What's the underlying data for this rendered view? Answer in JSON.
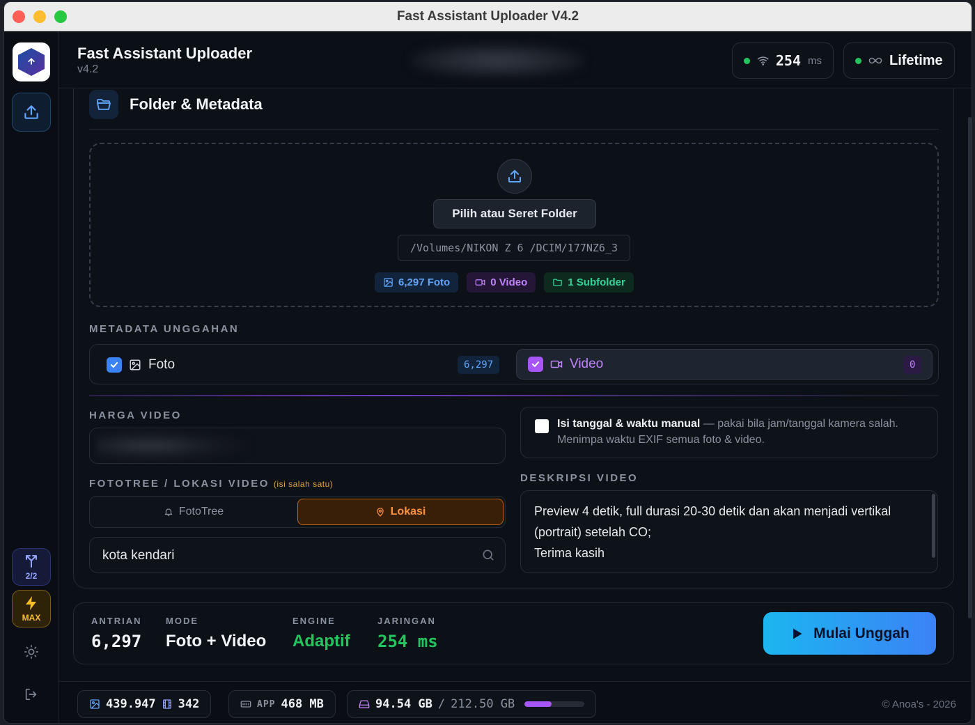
{
  "window": {
    "title": "Fast Assistant Uploader V4.2"
  },
  "header": {
    "app_name": "Fast Assistant Uploader",
    "version": "v4.2",
    "ping_value": "254",
    "ping_unit": "ms",
    "license": "Lifetime"
  },
  "sidebar": {
    "logo_text": "Fast Assistant Uploader",
    "page_indicator": "2/2",
    "max_label": "MAX"
  },
  "folder": {
    "section_title": "Folder & Metadata",
    "choose_button": "Pilih atau Seret Folder",
    "path": "/Volumes/NIKON Z 6 /DCIM/177NZ6_3",
    "badge_photo": "6,297 Foto",
    "badge_video": "0 Video",
    "badge_subfolder": "1 Subfolder"
  },
  "metadata": {
    "label": "METADATA UNGGAHAN",
    "photo_label": "Foto",
    "photo_count": "6,297",
    "photo_checked": true,
    "video_label": "Video",
    "video_count": "0",
    "video_checked": true
  },
  "harga_video": {
    "label": "HARGA VIDEO",
    "value": ""
  },
  "lokasi": {
    "label": "FOTOTREE / LOKASI VIDEO",
    "hint": "(isi salah satu)",
    "tab_fototree": "FotoTree",
    "tab_lokasi": "Lokasi",
    "active_tab": "Lokasi",
    "input_value": "kota kendari"
  },
  "manual_datetime": {
    "checked": false,
    "title": "Isi tanggal & waktu manual",
    "description": "— pakai bila jam/tanggal kamera salah. Menimpa waktu EXIF semua foto & video."
  },
  "deskripsi": {
    "label": "DESKRIPSI VIDEO",
    "text": "Preview 4 detik, full durasi 20-30 detik dan akan menjadi vertikal (portrait) setelah CO;\nTerima kasih"
  },
  "stats": {
    "antrian_label": "ANTRIAN",
    "antrian_value": "6,297",
    "mode_label": "MODE",
    "mode_value": "Foto + Video",
    "engine_label": "ENGINE",
    "engine_value": "Adaptif",
    "jaringan_label": "JARINGAN",
    "jaringan_value": "254 ms",
    "start_button": "Mulai Unggah"
  },
  "footer": {
    "photo_total": "439.947",
    "video_total": "342",
    "app_label": "APP",
    "app_memory": "468 MB",
    "disk_used": "94.54 GB",
    "disk_separator": "/",
    "disk_total": "212.50 GB",
    "disk_fraction": 0.445,
    "copyright": "© Anoa's - 2026"
  },
  "colors": {
    "accent_blue": "#3b82f6",
    "accent_purple": "#a855f7",
    "accent_orange": "#fb923c",
    "accent_green": "#22c55e",
    "background": "#0b0f16"
  }
}
